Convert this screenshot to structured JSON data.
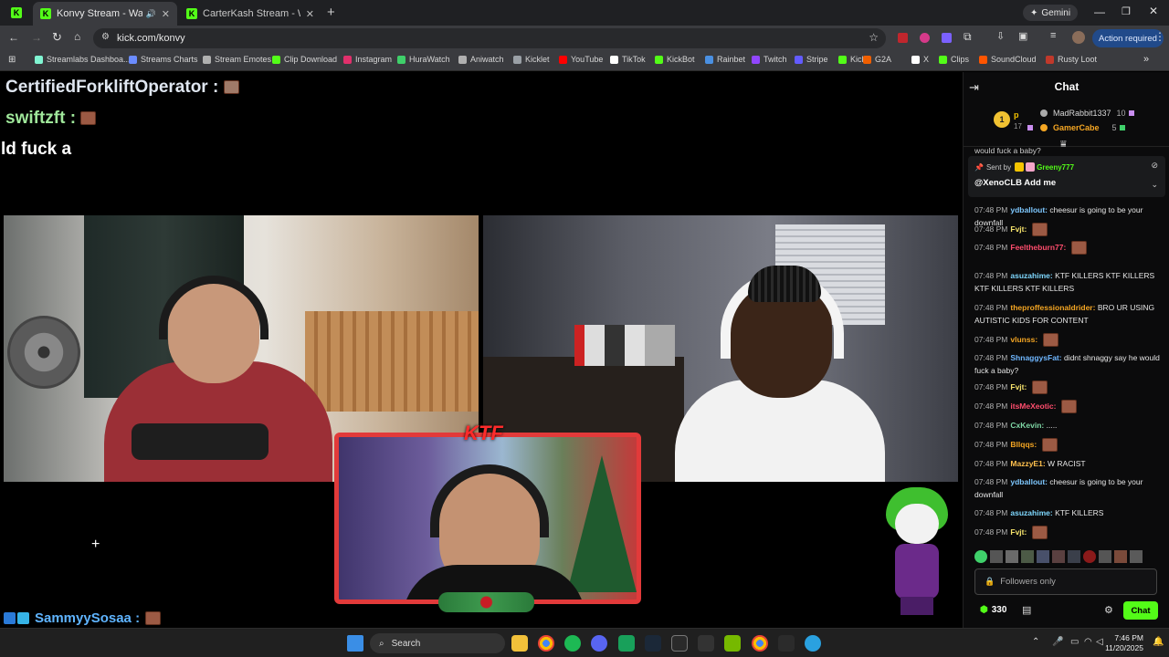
{
  "browser": {
    "tabs": [
      {
        "title": "Konvy Stream - Watch Live"
      },
      {
        "title": "CarterKash Stream - Watch Live"
      }
    ],
    "url": "kick.com/konvy",
    "profile_button": "Gemini",
    "action_required": "Action required",
    "bookmarks": [
      {
        "label": "Streamlabs Dashboa...",
        "color": "#80f5d2"
      },
      {
        "label": "Streams Charts",
        "color": "#6b8cff"
      },
      {
        "label": "Stream Emotes",
        "color": "#b0b0b0"
      },
      {
        "label": "Clip Download",
        "color": "#53fc18"
      },
      {
        "label": "Instagram",
        "color": "#e1306c"
      },
      {
        "label": "HuraWatch",
        "color": "#3fd06a"
      },
      {
        "label": "Aniwatch",
        "color": "#b0b0b0"
      },
      {
        "label": "Kicklet",
        "color": "#9aa0a6"
      },
      {
        "label": "YouTube",
        "color": "#ff0000"
      },
      {
        "label": "TikTok",
        "color": "#ffffff"
      },
      {
        "label": "KickBot",
        "color": "#53fc18"
      },
      {
        "label": "Rainbet",
        "color": "#4a90e2"
      },
      {
        "label": "Twitch",
        "color": "#9146ff"
      },
      {
        "label": "Stripe",
        "color": "#635bff"
      },
      {
        "label": "Kick",
        "color": "#53fc18"
      },
      {
        "label": "G2A",
        "color": "#f05f00"
      },
      {
        "label": "X",
        "color": "#ffffff"
      },
      {
        "label": "Clips",
        "color": "#53fc18"
      },
      {
        "label": "SoundCloud",
        "color": "#ff5500"
      },
      {
        "label": "Rusty Loot",
        "color": "#c0392b"
      }
    ]
  },
  "stream": {
    "overlay_lines": [
      {
        "user": "CertifiedForkliftOperator :"
      },
      {
        "user": "swiftzft :"
      },
      {
        "text": "ld fuck a"
      }
    ],
    "bottom_user": "SammyySosaa :",
    "overlay_logo": "KTF"
  },
  "chat": {
    "header": "Chat",
    "leaderboard": {
      "rank": "1",
      "top_user": "p",
      "top_count": "17",
      "entries": [
        {
          "name": "MadRabbit1337",
          "count": "10",
          "color": "#d8d8d8"
        },
        {
          "name": "GamerCabe",
          "count": "5",
          "color": "#f5a623"
        }
      ]
    },
    "partial_line": "would fuck a baby?",
    "pinned": {
      "sent_by_label": "Sent by",
      "sender": "Greeny777",
      "message": "@XenoCLB Add me"
    },
    "messages": [
      {
        "time": "07:48 PM",
        "user": "ydballout:",
        "text": "cheesur is going to be your downfall",
        "color": "#7ec8ff"
      },
      {
        "time": "07:48 PM",
        "user": "Fvjt:",
        "text": "",
        "color": "#f5e26b"
      },
      {
        "time": "07:48 PM",
        "user": "Feeltheburn77:",
        "text": "",
        "color": "#ff4d6d"
      },
      {
        "time": "07:48 PM",
        "user": "asuzahime:",
        "text": "KTF KILLERS KTF KILLERS KTF KILLERS KTF KILLERS",
        "color": "#7fd8ff"
      },
      {
        "time": "07:48 PM",
        "user": "theproffessionaldrider:",
        "text": "BRO UR USING AUTISTIC KIDS FOR CONTENT",
        "color": "#f5a623"
      },
      {
        "time": "07:48 PM",
        "user": "vlunss:",
        "text": "",
        "color": "#f5a623"
      },
      {
        "time": "07:48 PM",
        "user": "ShnaggysFat:",
        "text": "didnt shnaggy say he would fuck a baby?",
        "color": "#6fb7ff"
      },
      {
        "time": "07:48 PM",
        "user": "Fvjt:",
        "text": "",
        "color": "#f5e26b"
      },
      {
        "time": "07:48 PM",
        "user": "itsMeXeotic:",
        "text": "",
        "color": "#ff4d6d"
      },
      {
        "time": "07:48 PM",
        "user": "CxKevin:",
        "text": ".....",
        "color": "#7fd8a6"
      },
      {
        "time": "07:48 PM",
        "user": "Bllqqs:",
        "text": "",
        "color": "#f5a623"
      },
      {
        "time": "07:48 PM",
        "user": "MazzyE1:",
        "text": "W RACIST",
        "color": "#ffc04d"
      },
      {
        "time": "07:48 PM",
        "user": "ydballout:",
        "text": "cheesur is going to be your downfall",
        "color": "#7ec8ff"
      },
      {
        "time": "07:48 PM",
        "user": "asuzahime:",
        "text": "KTF KILLERS",
        "color": "#7fd8ff"
      },
      {
        "time": "07:48 PM",
        "user": "Fvjt:",
        "text": "",
        "color": "#f5e26b"
      }
    ],
    "input_placeholder": "Followers only",
    "points": "330",
    "send_label": "Chat"
  },
  "taskbar": {
    "search_placeholder": "Search",
    "time": "7:46 PM",
    "date": "11/20/2025"
  }
}
